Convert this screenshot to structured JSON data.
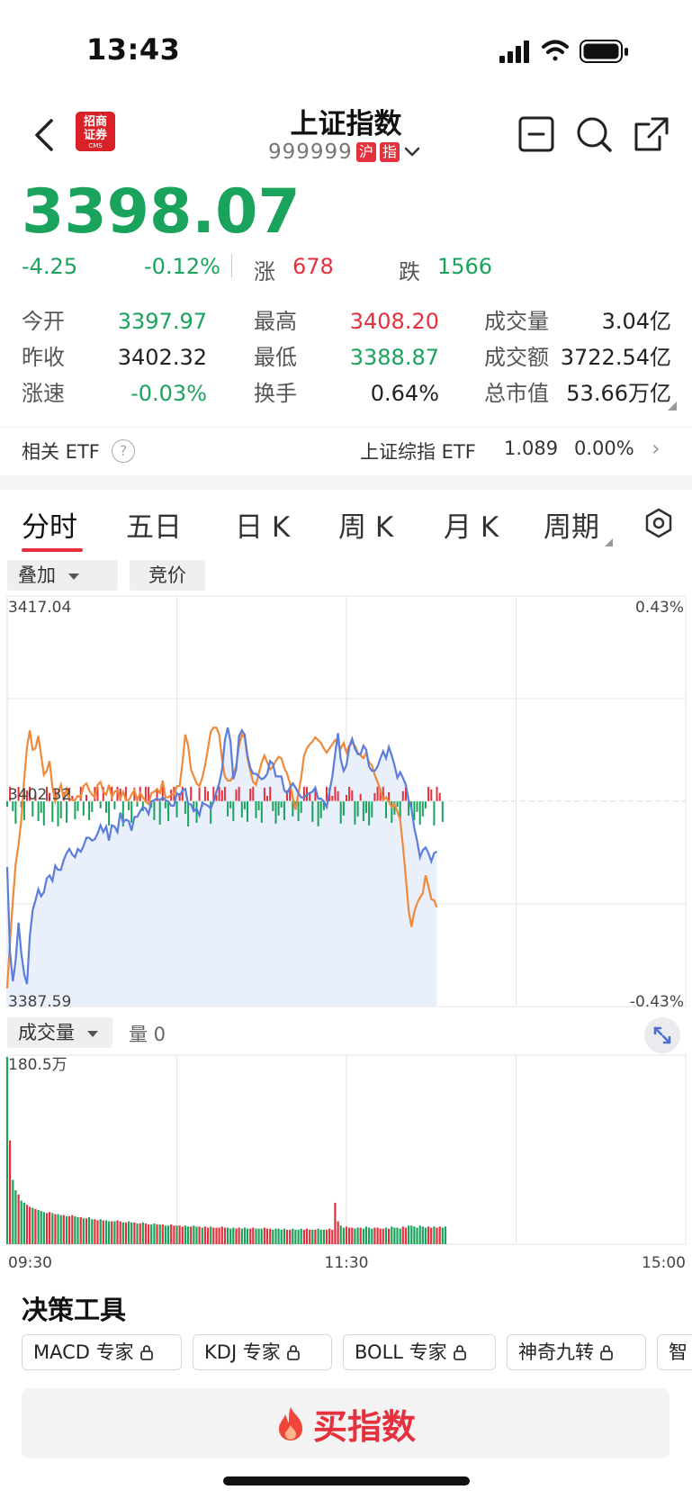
{
  "status_bar": {
    "time": "13:43"
  },
  "header": {
    "broker_logo_line1": "招商",
    "broker_logo_line2": "证券",
    "broker_logo_sub": "CMS",
    "title": "上证指数",
    "code": "999999",
    "tag1": "沪",
    "tag2": "指"
  },
  "quote": {
    "price": "3398.07",
    "change": "-4.25",
    "change_pct": "-0.12%",
    "up_label": "涨",
    "up_count": "678",
    "down_label": "跌",
    "down_count": "1566",
    "stats": [
      {
        "label": "今开",
        "value": "3397.97",
        "color": "#1aa35c"
      },
      {
        "label": "最高",
        "value": "3408.20",
        "color": "#e5313d"
      },
      {
        "label": "成交量",
        "value": "3.04亿",
        "color": "#222222"
      },
      {
        "label": "昨收",
        "value": "3402.32",
        "color": "#222222"
      },
      {
        "label": "最低",
        "value": "3388.87",
        "color": "#1aa35c"
      },
      {
        "label": "成交额",
        "value": "3722.54亿",
        "color": "#222222"
      },
      {
        "label": "涨速",
        "value": "-0.03%",
        "color": "#1aa35c"
      },
      {
        "label": "换手",
        "value": "0.64%",
        "color": "#222222"
      },
      {
        "label": "总市值",
        "value": "53.66万亿",
        "color": "#222222"
      }
    ]
  },
  "etf": {
    "label": "相关 ETF",
    "help": "?",
    "name": "上证综指 ETF",
    "price": "1.089",
    "pct": "0.00%",
    "arrow": "›"
  },
  "tabs": [
    "分时",
    "五日",
    "日 K",
    "周 K",
    "月 K",
    "周期"
  ],
  "chart_controls": {
    "overlay": "叠加",
    "auction": "竞价",
    "volume": "成交量",
    "volume_value": "量 0"
  },
  "colors": {
    "up": "#e5313d",
    "down": "#1aa35c",
    "index_line": "#5b7ddb",
    "avg_line": "#ef8a3a"
  },
  "chart_data": {
    "type": "line",
    "y_top": "3417.04",
    "y_prev_close": "3402.32",
    "y_bottom": "3387.59",
    "pct_top": "0.43%",
    "pct_bottom": "-0.43%",
    "ylim": [
      3387.59,
      3417.04
    ],
    "volume_max_label": "180.5万",
    "x_labels": [
      "09:30",
      "11:30",
      "15:00"
    ],
    "minutes_total": 240,
    "series": [
      {
        "values": [
          3397.6,
          3391.5,
          3389.4,
          3390.9,
          3393.6,
          3391.4,
          3389.9,
          3389.2,
          3392.6,
          3394.5,
          3395.2,
          3396.0,
          3395.5,
          3395.8,
          3396.8,
          3397.0,
          3396.6,
          3397.7,
          3397.4,
          3397.4,
          3398.1,
          3398.6,
          3398.9,
          3398.5,
          3398.3,
          3398.9,
          3398.7,
          3399.1,
          3399.7,
          3399.7,
          3399.5,
          3399.6,
          3400.0,
          3400.6,
          3400.1,
          3400.5,
          3399.5,
          3400.6,
          3400.5,
          3400.1,
          3401.5,
          3400.8,
          3401.0,
          3400.9,
          3400.2,
          3401.2,
          3401.2,
          3401.6,
          3401.9,
          3401.8,
          3401.4,
          3402.3,
          3402.4,
          3402.5,
          3402.4,
          3402.6,
          3402.4,
          3402.3,
          3402.0,
          3402.0,
          3402.9,
          3402.7,
          3403.1,
          3403.2,
          3402.1,
          3402.1,
          3401.6,
          3401.8,
          3401.3,
          3402.2,
          3402.1,
          3402.0,
          3401.8,
          3402.3,
          3403.0,
          3403.6,
          3404.6,
          3406.7,
          3407.6,
          3406.6,
          3403.9,
          3404.6,
          3407.0,
          3407.4,
          3407.1,
          3405.6,
          3404.7,
          3404.3,
          3404.3,
          3404.1,
          3403.9,
          3404.0,
          3404.3,
          3405.2,
          3405.0,
          3404.1,
          3404.1,
          3404.1,
          3403.1,
          3402.9,
          3403.3,
          3403.6,
          3403.3,
          3402.9,
          3402.6,
          3402.6,
          3402.8,
          3402.9,
          3403.0,
          3403.3,
          3402.5,
          3402.5,
          3402.3,
          3401.9,
          3403.0,
          3404.1,
          3405.7,
          3407.2,
          3405.3,
          3404.5,
          3404.9,
          3406.2,
          3406.8,
          3406.1,
          3405.7,
          3405.7,
          3406.3,
          3406.0,
          3404.8,
          3404.5,
          3404.5,
          3404.8,
          3405.4,
          3405.9,
          3405.4,
          3406.2,
          3405.6,
          3404.9,
          3404.0,
          3404.4,
          3404.0,
          3403.5,
          3402.4,
          3401.8,
          3400.4,
          3399.5,
          3398.3,
          3398.8,
          3399.0,
          3398.6,
          3398.0,
          3398.6,
          3398.7
        ],
        "color": "#5b7ddb"
      },
      {
        "values": [
          3388.9,
          3392.2,
          3395.2,
          3397.8,
          3399.2,
          3401.0,
          3403.9,
          3406.2,
          3407.4,
          3406.0,
          3406.1,
          3407.0,
          3405.6,
          3404.2,
          3404.5,
          3405.2,
          3403.3,
          3402.3,
          3402.9,
          3403.5,
          3402.5,
          3403.2,
          3402.5,
          3402.4,
          3402.4,
          3402.7,
          3402.6,
          3403.4,
          3403.6,
          3403.1,
          3402.8,
          3402.6,
          3403.5,
          3403.7,
          3403.0,
          3402.8,
          3403.5,
          3402.6,
          3403.0,
          3403.1,
          3402.5,
          3403.0,
          3402.4,
          3402.4,
          3402.8,
          3403.1,
          3402.4,
          3402.9,
          3402.6,
          3402.3,
          3402.1,
          3402.9,
          3403.0,
          3403.2,
          3402.9,
          3403.8,
          3402.6,
          3402.6,
          3402.8,
          3402.8,
          3403.4,
          3403.4,
          3405.1,
          3407.1,
          3406.3,
          3404.6,
          3404.1,
          3403.6,
          3403.4,
          3404.0,
          3404.9,
          3406.1,
          3407.3,
          3407.6,
          3407.6,
          3407.1,
          3405.3,
          3404.1,
          3403.8,
          3403.8,
          3404.2,
          3404.9,
          3406.3,
          3407.1,
          3406.9,
          3405.4,
          3404.5,
          3403.7,
          3403.5,
          3404.3,
          3405.1,
          3405.6,
          3405.1,
          3404.6,
          3404.8,
          3405.2,
          3405.5,
          3405.4,
          3404.7,
          3404.3,
          3403.6,
          3402.6,
          3401.7,
          3402.9,
          3404.0,
          3405.6,
          3406.1,
          3406.4,
          3406.6,
          3406.9,
          3406.7,
          3406.5,
          3406.1,
          3405.8,
          3406.1,
          3406.4,
          3406.7,
          3406.5,
          3406.1,
          3406.5,
          3405.8,
          3406.3,
          3406.5,
          3406.3,
          3405.8,
          3405.6,
          3405.4,
          3405.8,
          3405.1,
          3404.9,
          3404.2,
          3403.7,
          3403.1,
          3402.4,
          3402.6,
          3402.3,
          3401.9,
          3402.1,
          3401.6,
          3401.0,
          3399.1,
          3396.8,
          3394.5,
          3393.3,
          3394.4,
          3395.0,
          3395.4,
          3395.7,
          3397.0,
          3396.2,
          3395.3,
          3395.2,
          3394.7
        ],
        "color": "#ef8a3a"
      }
    ],
    "volume_values": [
      180.5,
      100,
      62,
      52,
      48,
      42,
      40,
      38,
      36,
      35,
      34,
      33,
      32,
      31,
      30,
      31,
      30,
      29,
      29,
      28,
      28,
      27,
      27,
      28,
      27,
      26,
      26,
      25,
      25,
      26,
      24,
      24,
      23,
      24,
      23,
      23,
      22,
      22,
      22,
      23,
      22,
      21,
      21,
      22,
      21,
      21,
      20,
      20,
      21,
      20,
      19,
      19,
      20,
      19,
      19,
      19,
      18,
      18,
      19,
      18,
      18,
      18,
      17,
      18,
      17,
      17,
      18,
      17,
      17,
      16,
      17,
      16,
      17,
      16,
      16,
      16,
      17,
      16,
      16,
      15,
      16,
      15,
      16,
      15,
      16,
      15,
      15,
      16,
      15,
      15,
      15,
      16,
      15,
      15,
      14,
      15,
      15,
      14,
      15,
      14,
      14,
      15,
      14,
      14,
      15,
      14,
      15,
      14,
      14,
      14,
      15,
      14,
      14,
      14,
      15,
      14,
      40,
      22,
      18,
      16,
      17,
      16,
      16,
      15,
      16,
      16,
      15,
      17,
      16,
      15,
      16,
      16,
      15,
      15,
      16,
      15,
      17,
      16,
      16,
      15,
      17,
      16,
      18,
      18,
      17,
      16,
      18,
      17,
      16,
      17,
      16,
      17,
      16,
      17,
      16,
      17
    ],
    "tick_direction": [
      0,
      1,
      0,
      0,
      1,
      0,
      0,
      1,
      1,
      0,
      1,
      0,
      0,
      0,
      1,
      1,
      0,
      1,
      0,
      0,
      1,
      0,
      1,
      1,
      0,
      0,
      1,
      0,
      1,
      0,
      0,
      1,
      1,
      0,
      1,
      0,
      0,
      1,
      0,
      1,
      1,
      0,
      1,
      0,
      0,
      1,
      0,
      1,
      0,
      1,
      1,
      0,
      0,
      1,
      0,
      1,
      0,
      0,
      1,
      1,
      0,
      1,
      1,
      0,
      0,
      1,
      0,
      0,
      1,
      0,
      1,
      1,
      0,
      1,
      1,
      1,
      1,
      1,
      0,
      0,
      0,
      1,
      1,
      0,
      0,
      0,
      1,
      1,
      0,
      0,
      0,
      1,
      1,
      1,
      0,
      0,
      0,
      0,
      0,
      1,
      1,
      0,
      0,
      0,
      0,
      1,
      1,
      1,
      0,
      1,
      0,
      0,
      0,
      1,
      1,
      1,
      1,
      1,
      0,
      0,
      1,
      1,
      1,
      0,
      0,
      1,
      0,
      0,
      0,
      0,
      1,
      1,
      1,
      1,
      0,
      1,
      0,
      0,
      0,
      0,
      1,
      1,
      0,
      0,
      0,
      0,
      0,
      0,
      0,
      1,
      1,
      0,
      1,
      1,
      0
    ]
  },
  "tools": {
    "title": "决策工具",
    "items": [
      "MACD 专家",
      "KDJ 专家",
      "BOLL 专家",
      "神奇九转",
      "智"
    ]
  },
  "buy_button": {
    "label": "买指数"
  }
}
